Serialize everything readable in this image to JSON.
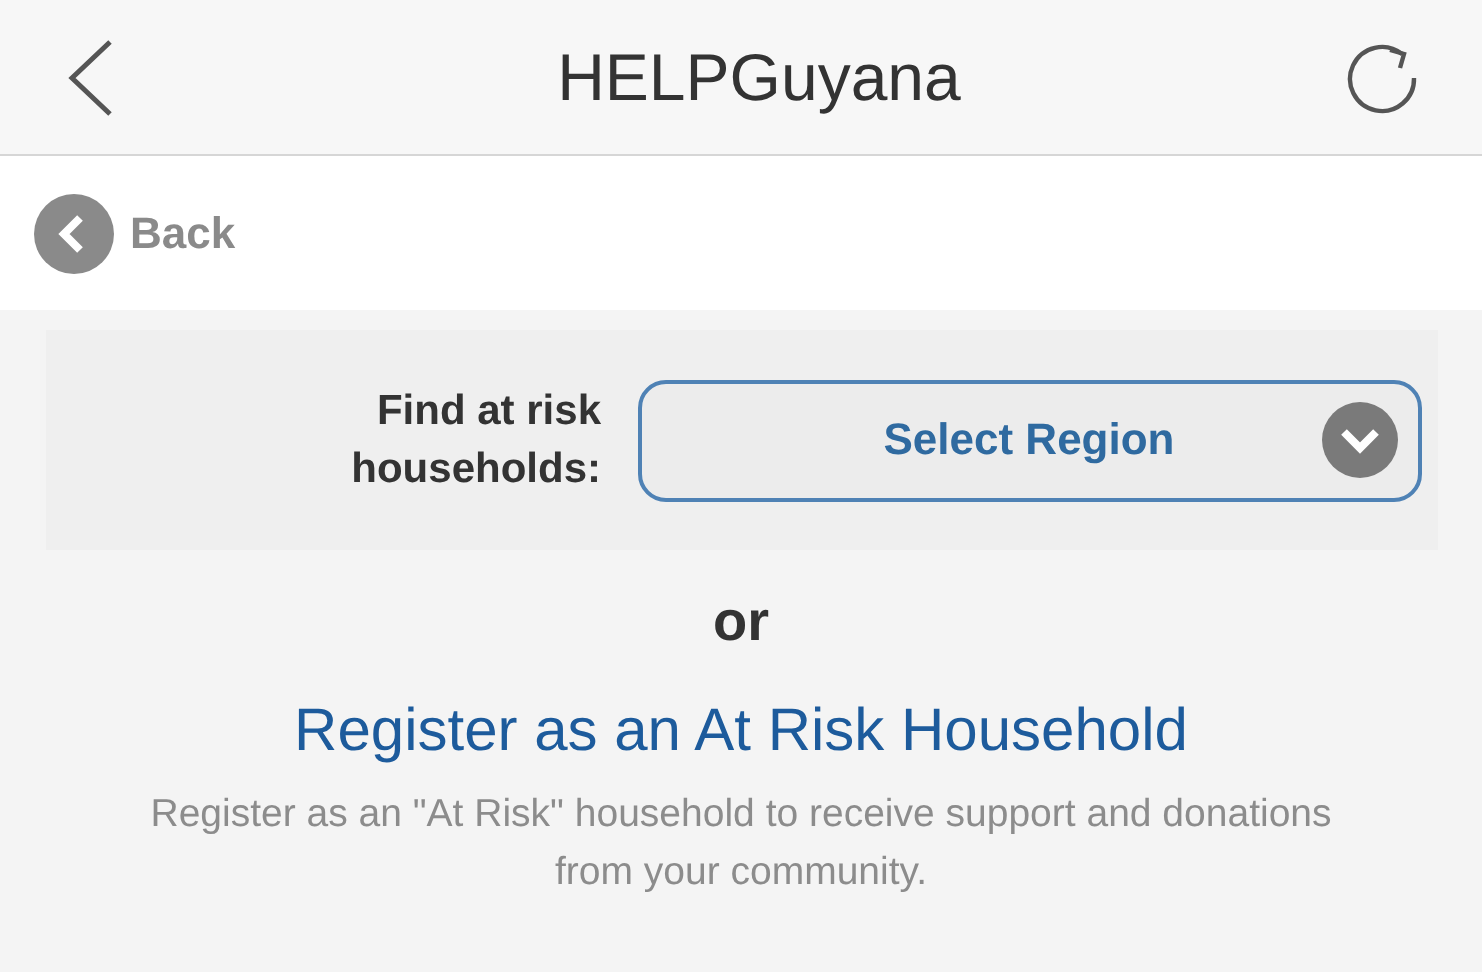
{
  "nav_bar": {
    "title": "HELPGuyana"
  },
  "back_link": {
    "label": "Back"
  },
  "region_finder": {
    "label": "Find at risk households:",
    "select_placeholder": "Select Region"
  },
  "separator": "or",
  "register_link": "Register as an At Risk Household",
  "register_description": "Register as an \"At Risk\" household to receive support and donations from your community."
}
